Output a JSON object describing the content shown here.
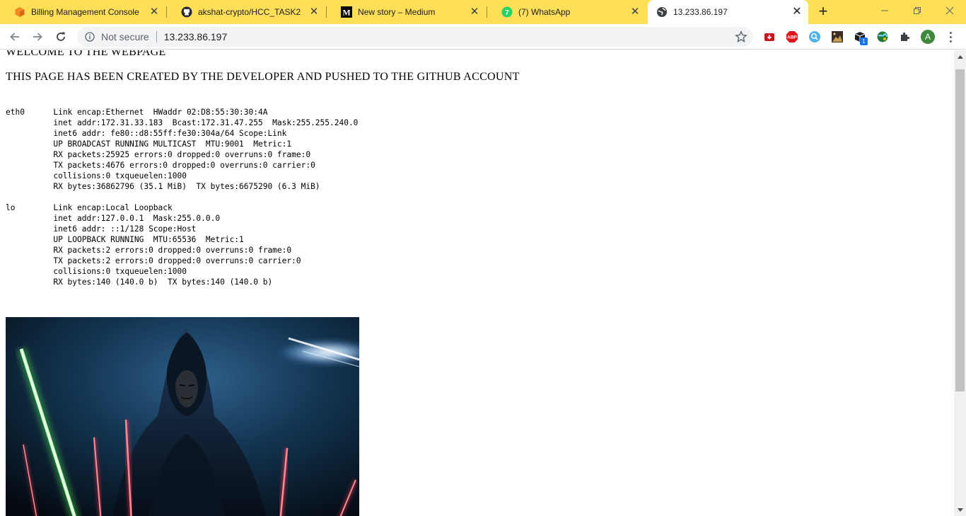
{
  "tabs": [
    {
      "label": "Billing Management Console",
      "icon": "aws-icon",
      "active": false
    },
    {
      "label": "akshat-crypto/HCC_TASK2",
      "icon": "github-icon",
      "active": false
    },
    {
      "label": "New story – Medium",
      "icon": "medium-icon",
      "active": false
    },
    {
      "label": "(7) WhatsApp",
      "icon": "whatsapp-icon",
      "active": false
    },
    {
      "label": "13.233.86.197",
      "icon": "globe-icon",
      "active": true
    }
  ],
  "omnibox": {
    "security_label": "Not secure",
    "url": "13.233.86.197"
  },
  "profile": {
    "initial": "A"
  },
  "extensions": {
    "badge_count": "1"
  },
  "page": {
    "welcome": "WELCOME TO THE WEBPAGE",
    "created": "THIS PAGE HAS BEEN CREATED BY THE DEVELOPER AND PUSHED TO THE GITHUB ACCOUNT",
    "ifconfig": "eth0      Link encap:Ethernet  HWaddr 02:D8:55:30:30:4A  \n          inet addr:172.31.33.183  Bcast:172.31.47.255  Mask:255.255.240.0\n          inet6 addr: fe80::d8:55ff:fe30:304a/64 Scope:Link\n          UP BROADCAST RUNNING MULTICAST  MTU:9001  Metric:1\n          RX packets:25925 errors:0 dropped:0 overruns:0 frame:0\n          TX packets:4676 errors:0 dropped:0 overruns:0 carrier:0\n          collisions:0 txqueuelen:1000 \n          RX bytes:36862796 (35.1 MiB)  TX bytes:6675290 (6.3 MiB)\n\nlo        Link encap:Local Loopback  \n          inet addr:127.0.0.1  Mask:255.0.0.0\n          inet6 addr: ::1/128 Scope:Host\n          UP LOOPBACK RUNNING  MTU:65536  Metric:1\n          RX packets:2 errors:0 dropped:0 overruns:0 frame:0\n          TX packets:2 errors:0 dropped:0 overruns:0 carrier:0\n          collisions:0 txqueuelen:1000 \n          RX bytes:140 (140.0 b)  TX bytes:140 (140.0 b)"
  },
  "colors": {
    "tabstrip": "#ffde58",
    "omnibox_bg": "#f1f3f4",
    "lightsaber_green": "#5cff5a",
    "lightsaber_red": "#ff3b4e"
  }
}
